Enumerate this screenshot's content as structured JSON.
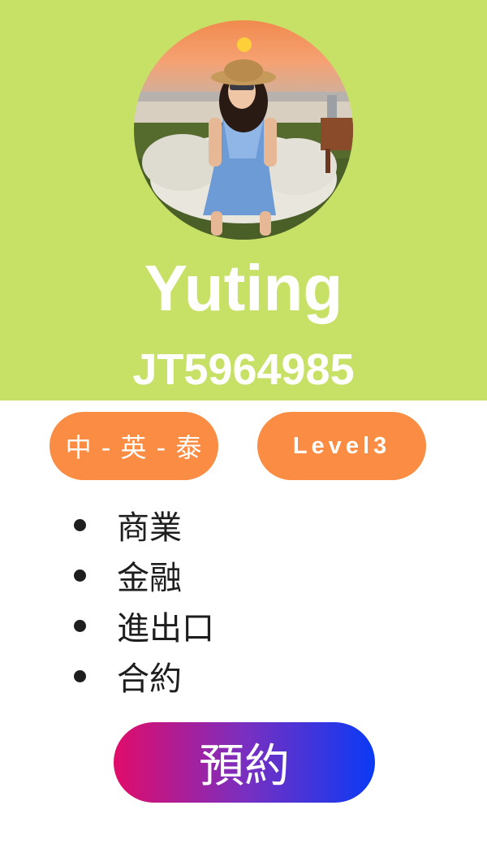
{
  "profile": {
    "name": "Yuting",
    "id": "JT5964985",
    "avatar_icon": "profile-photo"
  },
  "tags": {
    "languages": "中 - 英 - 泰",
    "level": "Level3"
  },
  "skills": [
    "商業",
    "金融",
    "進出口",
    "合約"
  ],
  "actions": {
    "book": "預約"
  },
  "colors": {
    "header_bg": "#c7e066",
    "pill_bg": "#fb8c43",
    "button_gradient_start": "#e10c6a",
    "button_gradient_end": "#0a3af5",
    "text_dark": "#1e1e1e"
  }
}
